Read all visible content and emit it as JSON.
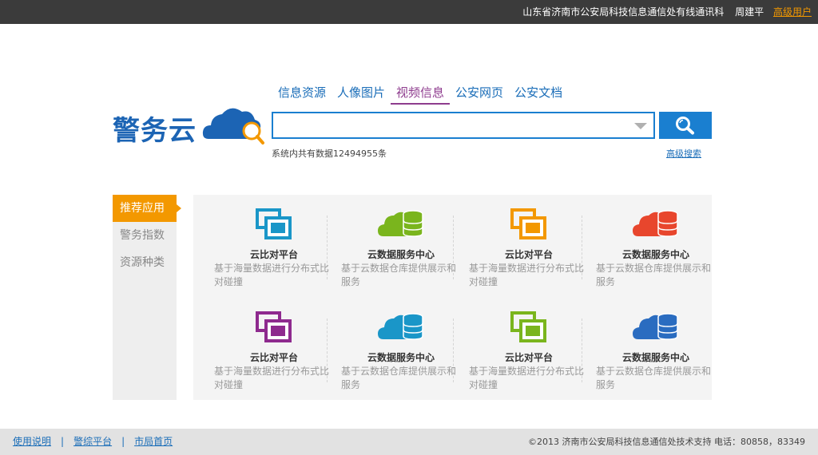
{
  "topbar": {
    "org": "山东省济南市公安局科技信息通信处有线通讯科",
    "user": "周建平",
    "role": "高级用户"
  },
  "logo": {
    "text": "警务云"
  },
  "search": {
    "tabs": [
      "信息资源",
      "人像图片",
      "视频信息",
      "公安网页",
      "公安文档"
    ],
    "active_tab": "视频信息",
    "value": "",
    "placeholder": "",
    "stat": "系统内共有数据12494955条",
    "advanced_link": "高级搜索"
  },
  "sidebar": {
    "items": [
      "推荐应用",
      "警务指数",
      "资源种类"
    ],
    "active": "推荐应用"
  },
  "apps": [
    {
      "title": "云比对平台",
      "desc": "基于海量数据进行分布式比对碰撞",
      "icon": "compare-icon",
      "color": "#1a96c8"
    },
    {
      "title": "云数据服务中心",
      "desc": "基于云数据仓库提供展示和服务",
      "icon": "cloud-database-icon",
      "color": "#7ab51d"
    },
    {
      "title": "云比对平台",
      "desc": "基于海量数据进行分布式比对碰撞",
      "icon": "compare-icon",
      "color": "#f39800"
    },
    {
      "title": "云数据服务中心",
      "desc": "基于云数据仓库提供展示和服务",
      "icon": "cloud-database-icon",
      "color": "#e8462d"
    },
    {
      "title": "云比对平台",
      "desc": "基于海量数据进行分布式比对碰撞",
      "icon": "compare-icon",
      "color": "#8e2a8e"
    },
    {
      "title": "云数据服务中心",
      "desc": "基于云数据仓库提供展示和服务",
      "icon": "cloud-database-icon",
      "color": "#1a96c8"
    },
    {
      "title": "云比对平台",
      "desc": "基于海量数据进行分布式比对碰撞",
      "icon": "compare-icon",
      "color": "#7ab51d"
    },
    {
      "title": "云数据服务中心",
      "desc": "基于云数据仓库提供展示和服务",
      "icon": "cloud-database-icon",
      "color": "#2a6cc0"
    }
  ],
  "footer": {
    "links": [
      "使用说明",
      "警综平台",
      "市局首页"
    ],
    "copyright": "©2013  济南市公安局科技信息通信处技术支持   电话：80858，83349"
  },
  "colors": {
    "brand_blue": "#1a7fd0",
    "accent_orange": "#f39800",
    "active_tab_purple": "#8e3c8e",
    "topbar_bg": "#3b3b3b"
  }
}
